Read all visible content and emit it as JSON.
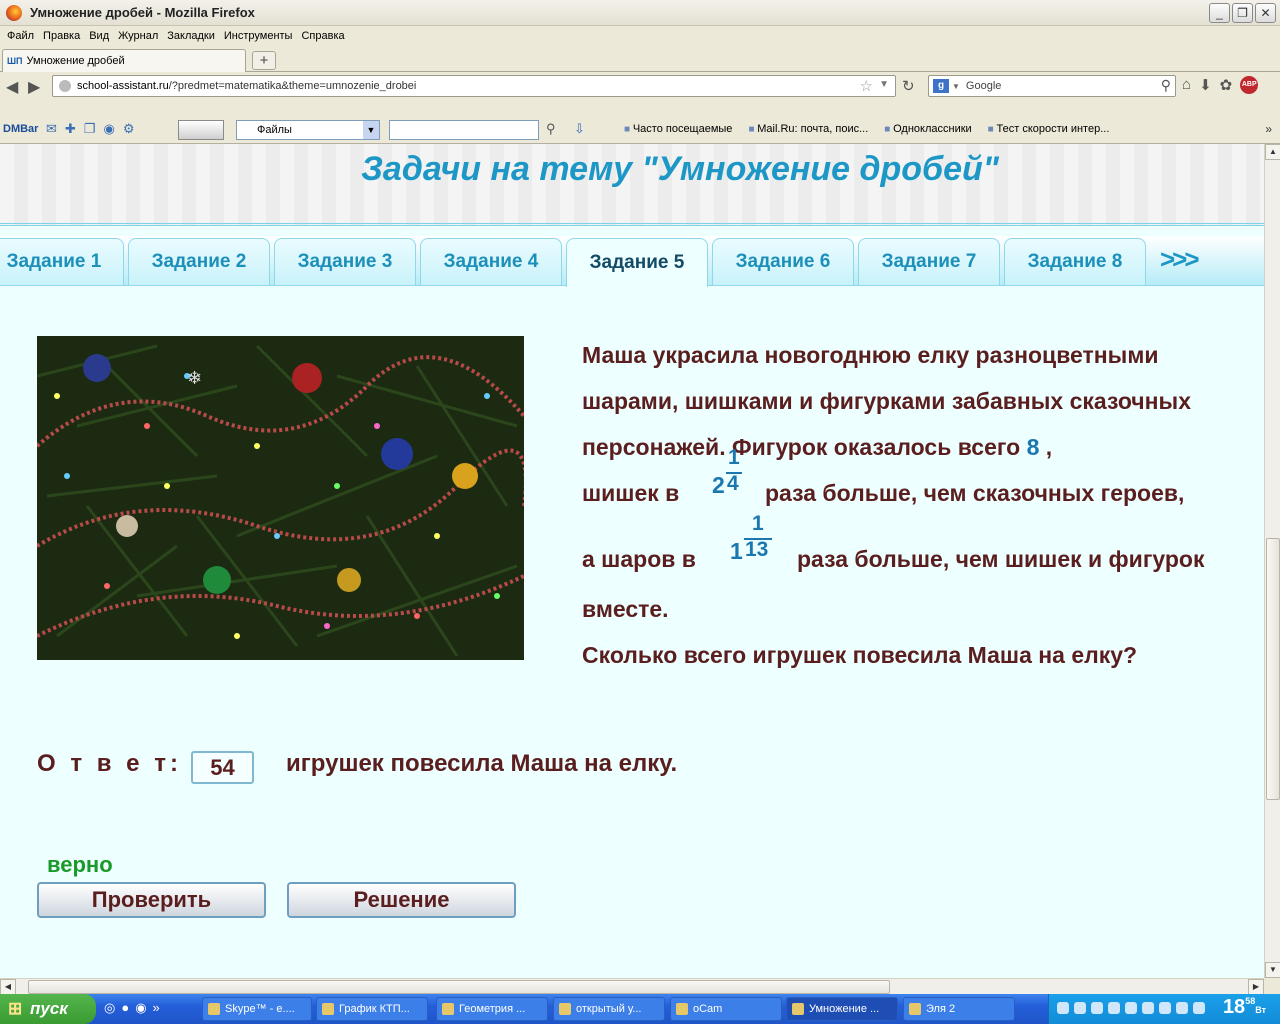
{
  "window": {
    "title": "Умножение дробей - Mozilla Firefox",
    "minimize": "_",
    "restore": "❐",
    "close": "✕"
  },
  "menu": [
    "Файл",
    "Правка",
    "Вид",
    "Журнал",
    "Закладки",
    "Инструменты",
    "Справка"
  ],
  "browser_tab": {
    "favicon_text": "ШП",
    "label": "Умножение дробей"
  },
  "new_tab_label": "+",
  "address": {
    "host": "school-assistant.ru",
    "path": "/?predmet=matematika&theme=umnozenie_drobei"
  },
  "search": {
    "engine": "g",
    "placeholder": "Google"
  },
  "toolbar": {
    "dmbar": "DMBar",
    "files_select": "Файлы",
    "bookmarks": [
      "Часто посещаемые",
      "Mail.Ru: почта, поис...",
      "Одноклассники",
      "Тест скорости интер..."
    ],
    "chevron": "»"
  },
  "page": {
    "title": "Задачи на тему \"Умножение дробей\"",
    "tabs": [
      "Задание 1",
      "Задание 2",
      "Задание 3",
      "Задание 4",
      "Задание 5",
      "Задание 6",
      "Задание 7",
      "Задание 8"
    ],
    "active_tab": "Задание 5",
    "more": ">>>",
    "problem": {
      "line1": "Маша украсила новогоднюю елку разноцветными",
      "line2": "шарами, шишками и фигурками забавных сказочных",
      "line3_text": "персонажей. Фигурок оказалось всего ",
      "figures": "8",
      "line3_end": " ,",
      "line4_start": "шишек в",
      "frac1": {
        "whole": "2",
        "num": "1",
        "den": "4"
      },
      "line4_end": "раза больше, чем сказочных героев,",
      "line5_start": "а шаров в",
      "frac2": {
        "whole": "1",
        "num": "1",
        "den": "13"
      },
      "line5_end": "раза больше, чем шишек и фигурок",
      "line6": "вместе.",
      "line7": "Сколько всего игрушек повесила Маша на елку?"
    },
    "answer_label": "О т в е т:",
    "answer_value": "54",
    "answer_tail": "игрушек повесила Маша на елку.",
    "verdict": "верно",
    "check_button": "Проверить",
    "solution_button": "Решение"
  },
  "taskbar": {
    "start": "пуск",
    "tasks": [
      "Skype™ - e....",
      "График КТП...",
      "Геометрия ...",
      "открытый у...",
      "oCam",
      "Умножение ...",
      "Эля 2"
    ],
    "active_task": "Умножение ...",
    "clock_hour": "18",
    "clock_min": "58",
    "clock_day": "Вт"
  },
  "colors": {
    "title_blue": "#1c97c6",
    "problem_text": "#5a1e1e",
    "fraction_blue": "#1a77b0",
    "correct_green": "#1a9a2a",
    "page_bg": "#eeffff"
  }
}
